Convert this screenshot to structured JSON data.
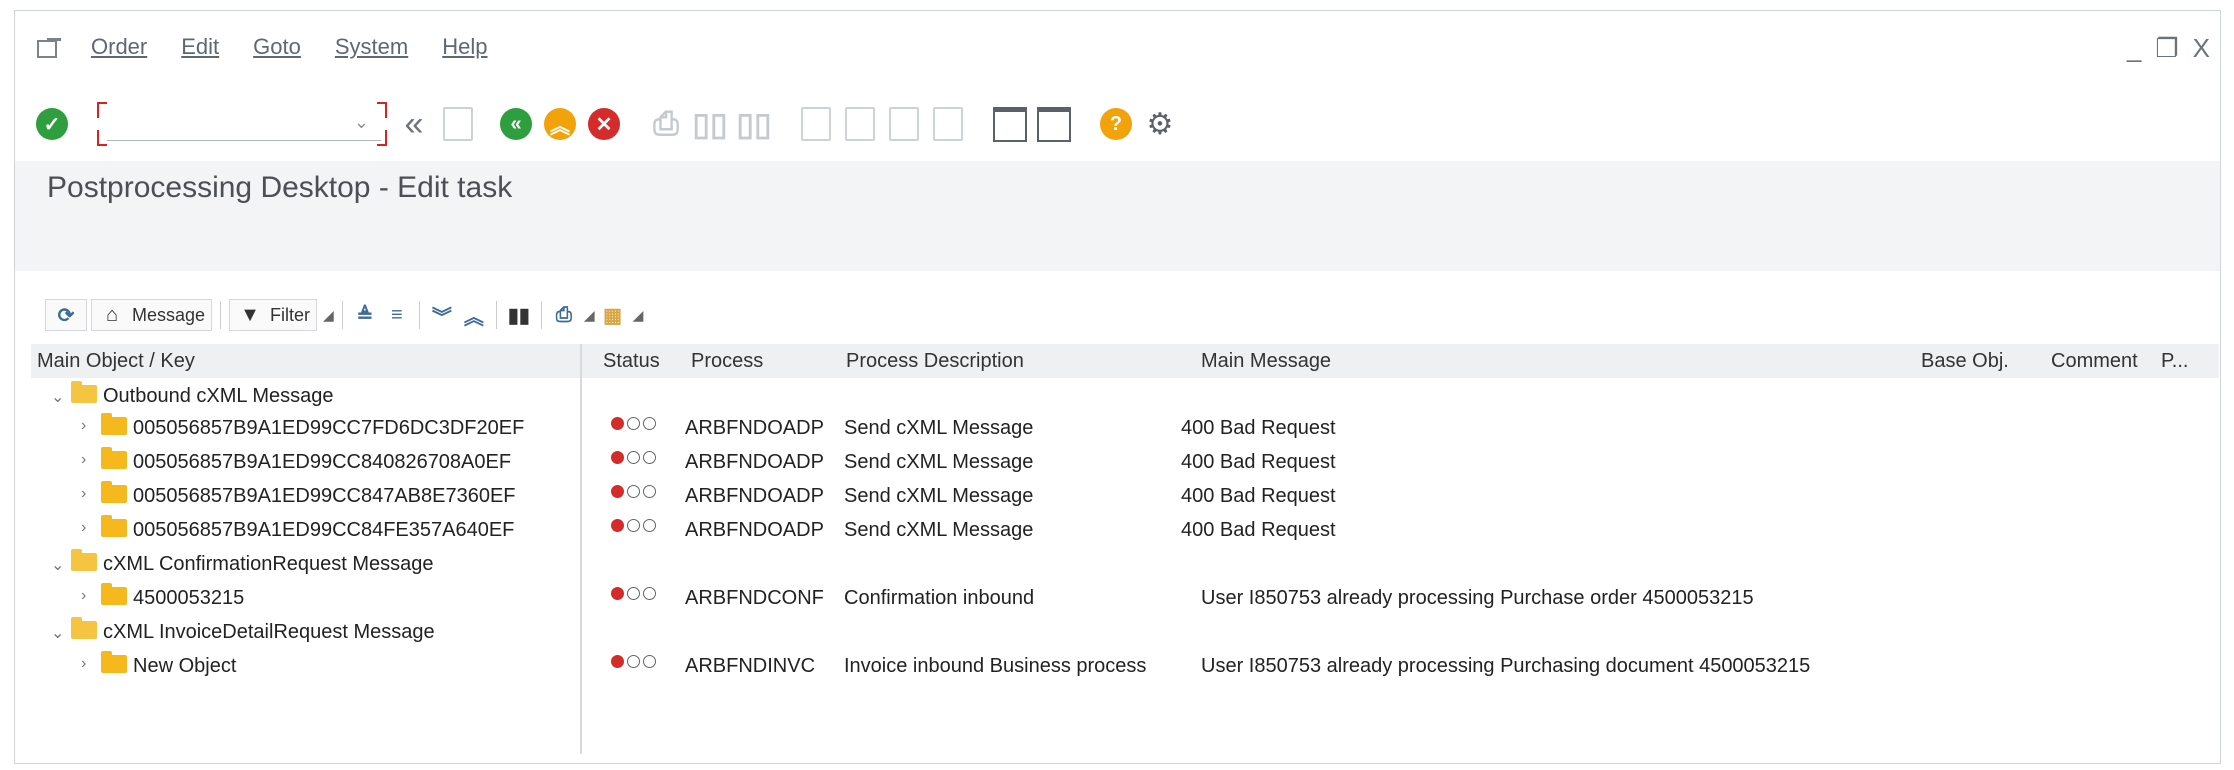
{
  "menubar": {
    "items": [
      "Order",
      "Edit",
      "Goto",
      "System",
      "Help"
    ],
    "window_controls": [
      "_",
      "❐",
      "X"
    ]
  },
  "toolbar": {
    "command_field": {
      "value": "",
      "placeholder": ""
    },
    "icons": [
      "check-icon",
      "back-double-icon",
      "save-icon",
      "back-icon",
      "exit-icon",
      "cancel-icon",
      "print-icon",
      "find-icon",
      "find-next-icon",
      "first-page-icon",
      "previous-page-icon",
      "next-page-icon",
      "last-page-icon",
      "new-session-icon",
      "shortcut-icon",
      "help-icon",
      "settings-icon"
    ]
  },
  "title": "Postprocessing Desktop - Edit task",
  "alv_toolbar": {
    "message_label": "Message",
    "filter_label": "Filter"
  },
  "columns": {
    "main_object": "Main Object / Key",
    "status": "Status",
    "process": "Process",
    "process_description": "Process Description",
    "main_message": "Main Message",
    "base_obj": "Base Obj.",
    "comment": "Comment",
    "p": "P..."
  },
  "tree": [
    {
      "level": 0,
      "label": "Outbound cXML Message",
      "expanded": true
    },
    {
      "level": 1,
      "label": "005056857B9A1ED99CC7FD6DC3DF20EF",
      "status": "red",
      "process": "ARBFNDOADP",
      "process_description": "Send cXML Message",
      "main_message": "400 Bad Request"
    },
    {
      "level": 1,
      "label": "005056857B9A1ED99CC840826708A0EF",
      "status": "red",
      "process": "ARBFNDOADP",
      "process_description": "Send cXML Message",
      "main_message": "400 Bad Request"
    },
    {
      "level": 1,
      "label": "005056857B9A1ED99CC847AB8E7360EF",
      "status": "red",
      "process": "ARBFNDOADP",
      "process_description": "Send cXML Message",
      "main_message": "400 Bad Request"
    },
    {
      "level": 1,
      "label": "005056857B9A1ED99CC84FE357A640EF",
      "status": "red",
      "process": "ARBFNDOADP",
      "process_description": "Send cXML Message",
      "main_message": "400 Bad Request"
    },
    {
      "level": 0,
      "label": "cXML ConfirmationRequest Message",
      "expanded": true
    },
    {
      "level": 1,
      "label": "4500053215",
      "status": "red",
      "process": "ARBFNDCONF",
      "process_description": "Confirmation inbound",
      "main_message": "User I850753 already processing Purchase order 4500053215"
    },
    {
      "level": 0,
      "label": "cXML InvoiceDetailRequest Message",
      "expanded": true
    },
    {
      "level": 1,
      "label": "New Object",
      "status": "red",
      "process": "ARBFNDINVC",
      "process_description": "Invoice inbound Business process",
      "main_message": "User I850753 already processing Purchasing document 4500053215"
    }
  ],
  "colors": {
    "accent_green": "#2e9e3e",
    "status_red": "#d42b2b",
    "folder_yellow": "#f5b91e"
  }
}
